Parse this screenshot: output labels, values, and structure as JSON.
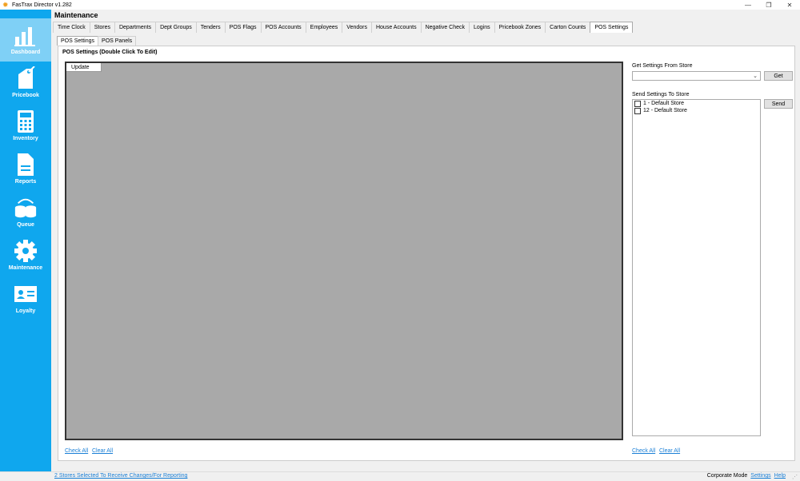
{
  "window": {
    "title": "FasTrax Director v1.282",
    "minimize": "—",
    "maximize": "❐",
    "close": "✕"
  },
  "sidebar": {
    "items": [
      {
        "label": "Dashboard",
        "icon": "dashboard-icon"
      },
      {
        "label": "Pricebook",
        "icon": "pricebook-icon"
      },
      {
        "label": "Inventory",
        "icon": "inventory-icon"
      },
      {
        "label": "Reports",
        "icon": "reports-icon"
      },
      {
        "label": "Queue",
        "icon": "queue-icon"
      },
      {
        "label": "Maintenance",
        "icon": "maintenance-icon"
      },
      {
        "label": "Loyalty",
        "icon": "loyalty-icon"
      }
    ],
    "active": "Dashboard",
    "color": "#0fa7ee"
  },
  "main": {
    "title": "Maintenance",
    "tabs": [
      "Time Clock",
      "Stores",
      "Departments",
      "Dept Groups",
      "Tenders",
      "POS Flags",
      "POS Accounts",
      "Employees",
      "Vendors",
      "House Accounts",
      "Negative Check",
      "Logins",
      "Pricebook Zones",
      "Carton Counts",
      "POS Settings"
    ],
    "active_tab": "POS Settings",
    "subtabs": [
      "POS Settings",
      "POS Panels"
    ],
    "active_subtab": "POS Settings",
    "section_title": "POS Settings (Double Click To Edit)",
    "update_label": "Update",
    "check_all": "Check All",
    "clear_all": "Clear All"
  },
  "right_panel": {
    "get_label": "Get Settings From Store",
    "get_button": "Get",
    "dropdown_value": "",
    "send_label": "Send Settings To Store",
    "send_button": "Send",
    "stores": [
      "1 - Default Store",
      "12 - Default Store"
    ],
    "check_all": "Check All",
    "clear_all": "Clear All"
  },
  "statusbar": {
    "stores_selected": "2 Stores Selected To Receive Changes/For Reporting",
    "mode": "Corporate Mode",
    "settings": "Settings",
    "help": "Help"
  }
}
